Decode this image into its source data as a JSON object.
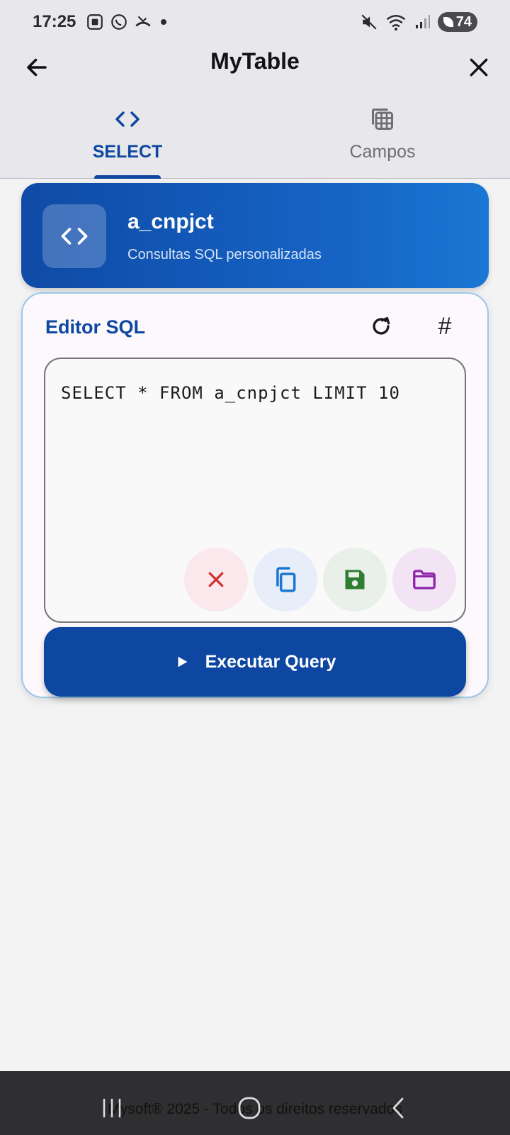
{
  "status_bar": {
    "time": "17:25",
    "battery": "74",
    "icons": [
      "screenshot-icon",
      "whatsapp-icon",
      "missed-call-icon",
      "dot-icon",
      "mute-icon",
      "wifi-icon",
      "signal-icon",
      "battery-icon"
    ]
  },
  "app_bar": {
    "title": "MyTable"
  },
  "tabs": [
    {
      "label": "SELECT",
      "icon": "code-icon",
      "active": true
    },
    {
      "label": "Campos",
      "icon": "table-icon",
      "active": false
    }
  ],
  "header": {
    "title": "a_cnpjct",
    "subtitle": "Consultas SQL personalizadas"
  },
  "editor": {
    "title": "Editor SQL",
    "hash_label": "#",
    "query": "SELECT * FROM a_cnpjct LIMIT 10",
    "run_label": "Executar Query"
  },
  "colors": {
    "primary": "#0e47a1",
    "clear": "#d32f2f",
    "copy": "#1976d2",
    "save": "#2e7d32",
    "open": "#8e24aa"
  },
  "footer": {
    "text": "Mysoft® 2025 - Todos os direitos reservados"
  }
}
